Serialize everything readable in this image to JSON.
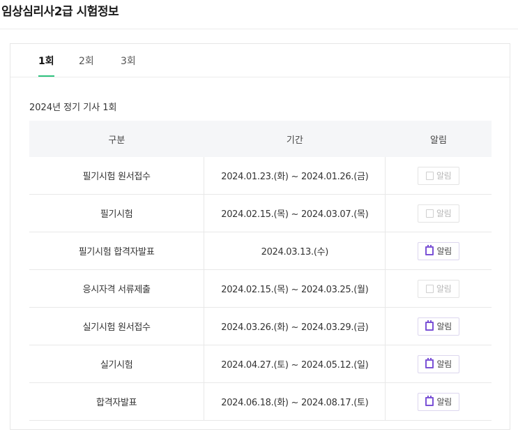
{
  "page": {
    "title": "임상심리사2급 시험정보"
  },
  "tabs": [
    {
      "label": "1회",
      "active": true
    },
    {
      "label": "2회",
      "active": false
    },
    {
      "label": "3회",
      "active": false
    }
  ],
  "section_title": "2024년 정기 기사 1회",
  "table": {
    "headers": [
      "구분",
      "기간",
      "알림"
    ],
    "rows": [
      {
        "type": "필기시험 원서접수",
        "period": "2024.01.23.(화) ~ 2024.01.26.(금)",
        "alert_label": "알림",
        "alert_active": false
      },
      {
        "type": "필기시험",
        "period": "2024.02.15.(목) ~ 2024.03.07.(목)",
        "alert_label": "알림",
        "alert_active": false
      },
      {
        "type": "필기시험 합격자발표",
        "period": "2024.03.13.(수)",
        "alert_label": "알림",
        "alert_active": true
      },
      {
        "type": "응시자격 서류제출",
        "period": "2024.02.15.(목) ~ 2024.03.25.(월)",
        "alert_label": "알림",
        "alert_active": false
      },
      {
        "type": "실기시험 원서접수",
        "period": "2024.03.26.(화) ~ 2024.03.29.(금)",
        "alert_label": "알림",
        "alert_active": true
      },
      {
        "type": "실기시험",
        "period": "2024.04.27.(토) ~ 2024.05.12.(일)",
        "alert_label": "알림",
        "alert_active": true
      },
      {
        "type": "합격자발표",
        "period": "2024.06.18.(화) ~ 2024.08.17.(토)",
        "alert_label": "알림",
        "alert_active": true
      }
    ]
  },
  "colors": {
    "tab_underline": "#2ec27e",
    "alert_icon_active": "#7b52d6",
    "header_bg": "#f5f6f8"
  },
  "icons": {
    "alert_icon": "calendar-icon"
  }
}
